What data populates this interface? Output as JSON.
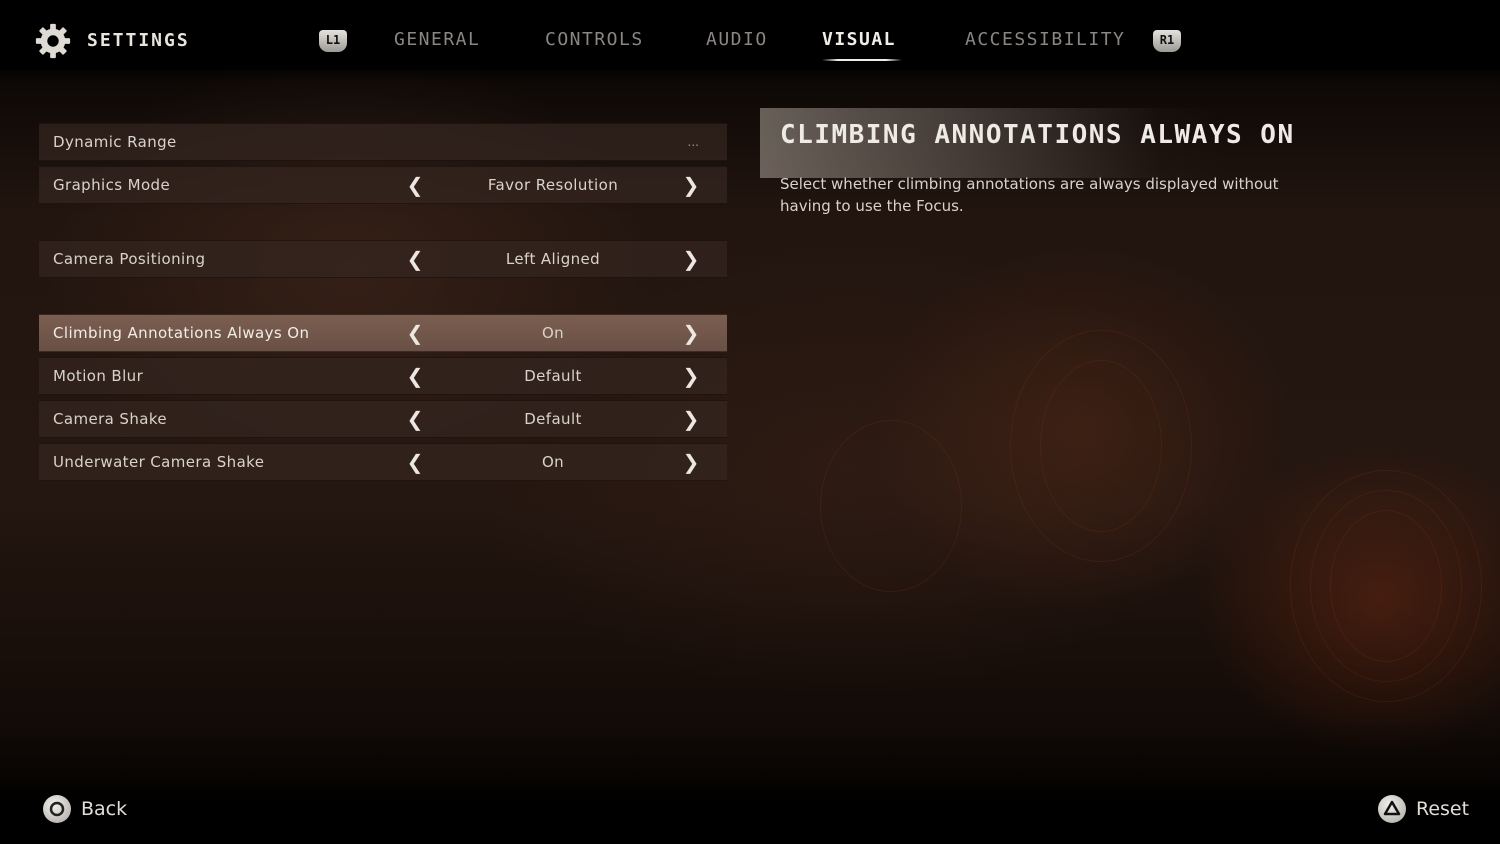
{
  "header": {
    "title": "SETTINGS",
    "icon": "gear-icon",
    "left_shoulder": "L1",
    "right_shoulder": "R1",
    "tabs": [
      {
        "label": "GENERAL",
        "active": false
      },
      {
        "label": "CONTROLS",
        "active": false
      },
      {
        "label": "AUDIO",
        "active": false
      },
      {
        "label": "VISUAL",
        "active": true
      },
      {
        "label": "ACCESSIBILITY",
        "active": false
      }
    ]
  },
  "settings": [
    {
      "label": "Dynamic Range",
      "value": "",
      "ellipsis": "...",
      "selected": false
    },
    {
      "label": "Graphics Mode",
      "value": "Favor Resolution",
      "selected": false
    },
    {
      "label": "Camera Positioning",
      "value": "Left Aligned",
      "selected": false
    },
    {
      "label": "Climbing Annotations Always On",
      "value": "On",
      "selected": true
    },
    {
      "label": "Motion Blur",
      "value": "Default",
      "selected": false
    },
    {
      "label": "Camera Shake",
      "value": "Default",
      "selected": false
    },
    {
      "label": "Underwater Camera Shake",
      "value": "On",
      "selected": false
    }
  ],
  "arrows": {
    "left": "❮",
    "right": "❯"
  },
  "description": {
    "title": "CLIMBING ANNOTATIONS ALWAYS ON",
    "body": "Select whether climbing annotations are always displayed without having to use the Focus."
  },
  "footer": {
    "back": {
      "label": "Back",
      "icon": "circle-button-icon"
    },
    "reset": {
      "label": "Reset",
      "icon": "triangle-button-icon"
    }
  }
}
